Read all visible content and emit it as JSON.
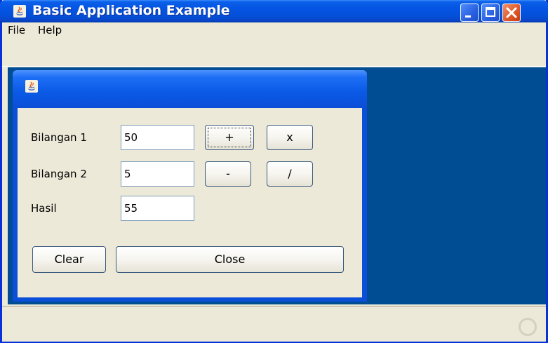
{
  "window": {
    "title": "Basic Application Example",
    "icon": "java-coffee-icon",
    "controls": [
      "minimize-icon",
      "maximize-icon",
      "close-icon"
    ]
  },
  "menu": {
    "items": [
      {
        "label": "File"
      },
      {
        "label": "Help"
      }
    ]
  },
  "internal_frame": {
    "icon": "java-coffee-icon",
    "form": {
      "bilangan1": {
        "label": "Bilangan 1",
        "value": "50"
      },
      "bilangan2": {
        "label": "Bilangan 2",
        "value": "5"
      },
      "hasil": {
        "label": "Hasil",
        "value": "55"
      }
    },
    "buttons": {
      "plus": "+",
      "multiply": "x",
      "minus": "-",
      "divide": "/",
      "clear": "Clear",
      "close": "Close"
    }
  },
  "status_bar": {
    "busy_icon": "busy-indicator-icon"
  },
  "colors": {
    "title_bar": "#0554e3",
    "desktop_background": "#004d93",
    "panel_background": "#ece9d8",
    "close_button": "#e15a2b"
  }
}
